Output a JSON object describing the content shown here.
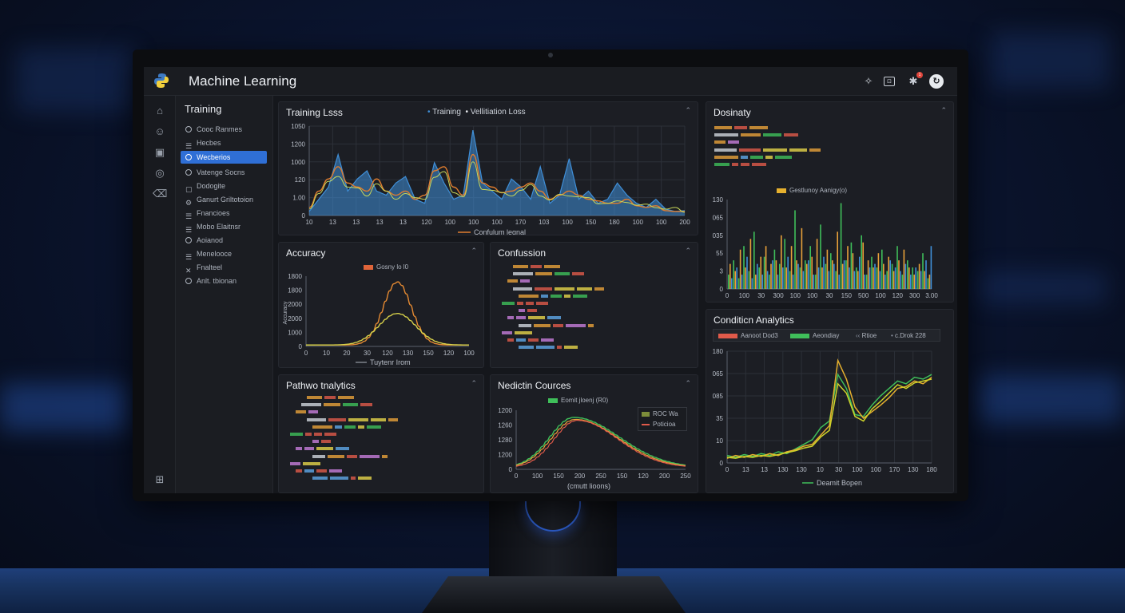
{
  "app": {
    "title": "Machine Learning",
    "icons": [
      "python-logo-icon",
      "share-icon",
      "window-icon",
      "bell-icon",
      "avatar"
    ],
    "notification_count": "1"
  },
  "rail": {
    "icons": [
      "home-icon",
      "people-icon",
      "calendar-icon",
      "chat-icon",
      "trash-icon",
      "box-icon"
    ]
  },
  "sidebar": {
    "title": "Training",
    "items": [
      {
        "label": "Cooc Ranmes",
        "active": false
      },
      {
        "label": "Hecbes",
        "active": false
      },
      {
        "label": "Wecberios",
        "active": true
      },
      {
        "label": "Vatenge Socns",
        "active": false
      },
      {
        "label": "Dodogite",
        "active": false
      },
      {
        "label": "Ganurt Griltotoion",
        "active": false
      },
      {
        "label": "Fnancioes",
        "active": false
      },
      {
        "label": "Mobo Elaitnsr",
        "active": false
      },
      {
        "label": "Aoianod",
        "active": false
      },
      {
        "label": "Menelooce",
        "active": false
      },
      {
        "label": "Fnalteel",
        "active": false
      },
      {
        "label": "Anlt. tbionan",
        "active": false
      }
    ]
  },
  "panels": {
    "training_loss": {
      "title": "Training Lsss",
      "legend_a": "Training",
      "legend_b": "Vellitiation Loss",
      "footer_legend": "Confulum legnal",
      "colors": {
        "a": "#3f8fd8",
        "b": "#e07d2e",
        "c": "#c9d85a"
      }
    },
    "accuracy": {
      "title": "Accuracy",
      "legend": "Gosny lo l0",
      "footer_legend": "Tuytenr Irom",
      "colors": {
        "a": "#e58a32",
        "b": "#d8d24a"
      }
    },
    "confusion": {
      "title": "Confussion"
    },
    "pathwo": {
      "title": "Pathwo tnalytics"
    },
    "prediction": {
      "title": "Nedictin Cources",
      "legend": "Eomit jloenj (R0)",
      "legend_box_a": "ROC Wa",
      "legend_box_b": "Poticioa",
      "footer_legend": "(cmutt lioons)",
      "colors": {
        "a": "#3fbf5a",
        "b": "#e8a13a",
        "c": "#e05a4a"
      }
    },
    "dosinaty": {
      "title": "Dosinaty",
      "chart_legend": "Gestlunoy Aanigy(o)"
    },
    "condition": {
      "title": "Conditicn Analytics",
      "legend_a": "Aanoot Dod3",
      "legend_b": "Aeondiay",
      "legend_c": "Rtioe",
      "legend_d": "c.Drok 228",
      "footer_legend": "Deamit Bopen",
      "colors": {
        "a": "#e05a4a",
        "b": "#3fbf5a",
        "c": "#e6b02e",
        "d": "#cfd42a"
      }
    }
  },
  "chart_data": [
    {
      "type": "area",
      "title": "Training Lsss",
      "y_ticks": [
        "1050",
        "1200",
        "1000",
        "120",
        "1.00",
        "0"
      ],
      "x_ticks": [
        "10",
        "13",
        "13",
        "13",
        "13",
        "120",
        "100",
        "100",
        "100",
        "170",
        "103",
        "100",
        "150",
        "180",
        "100",
        "100",
        "200"
      ],
      "series": [
        {
          "name": "Training",
          "values": [
            5,
            20,
            35,
            75,
            30,
            45,
            55,
            30,
            25,
            40,
            48,
            20,
            15,
            65,
            40,
            20,
            25,
            105,
            40,
            30,
            20,
            45,
            35,
            20,
            60,
            15,
            25,
            70,
            20,
            30,
            15,
            20,
            40,
            25,
            15,
            10,
            20,
            8,
            5,
            6
          ]
        },
        {
          "name": "Vellitiation Loss",
          "values": [
            10,
            30,
            45,
            60,
            40,
            35,
            30,
            45,
            30,
            25,
            30,
            20,
            25,
            55,
            60,
            35,
            25,
            75,
            40,
            35,
            28,
            30,
            35,
            40,
            30,
            20,
            25,
            30,
            25,
            20,
            18,
            15,
            15,
            20,
            12,
            10,
            12,
            6,
            5,
            5
          ]
        }
      ]
    },
    {
      "type": "line",
      "title": "Accuracy",
      "y_ticks": [
        "1800",
        "1800",
        "2000",
        "2000",
        "1000",
        "0"
      ],
      "x_ticks": [
        "0",
        "10",
        "20",
        "30",
        "120",
        "130",
        "150",
        "120",
        "100"
      ],
      "series": [
        {
          "name": "Gosny lo l0",
          "peak": 0.9
        },
        {
          "name": "Tuytenr Irom",
          "peak": 0.45
        }
      ]
    },
    {
      "type": "line",
      "title": "Nedictin Cources",
      "y_ticks": [
        "1200",
        "1260",
        "1280",
        "1200",
        "0"
      ],
      "x_ticks": [
        "0",
        "100",
        "150",
        "200",
        "250",
        "150",
        "120",
        "200",
        "250"
      ],
      "series": [
        {
          "name": "ROC Wa",
          "peak": 0.85
        },
        {
          "name": "Poticioa",
          "peak": 0.8
        }
      ]
    },
    {
      "type": "bar",
      "title": "Gestlunoy Aanigy(o)",
      "y_ticks": [
        "130",
        "065",
        "035",
        "55",
        "3",
        "0"
      ],
      "x_ticks": [
        "0",
        "100",
        "30",
        "300",
        "100",
        "100",
        "30",
        "150",
        "500",
        "100",
        "120",
        "300",
        "3.00"
      ],
      "series": [
        {
          "name": "green",
          "values": [
            20,
            40,
            15,
            60,
            25,
            80,
            30,
            45,
            20,
            55,
            35,
            70,
            25,
            110,
            30,
            40,
            60,
            20,
            90,
            35,
            50,
            25,
            120,
            40,
            65,
            30,
            75,
            20,
            45,
            30,
            55,
            25,
            35,
            60,
            20,
            40,
            30,
            25,
            50,
            15
          ]
        },
        {
          "name": "orange",
          "values": [
            35,
            25,
            55,
            30,
            70,
            20,
            45,
            60,
            35,
            40,
            75,
            30,
            60,
            40,
            85,
            35,
            45,
            70,
            30,
            55,
            40,
            80,
            35,
            60,
            50,
            25,
            65,
            40,
            30,
            50,
            35,
            45,
            25,
            40,
            55,
            30,
            20,
            35,
            25,
            20
          ]
        },
        {
          "name": "blue",
          "values": [
            15,
            30,
            20,
            45,
            15,
            35,
            20,
            25,
            40,
            20,
            30,
            45,
            20,
            35,
            25,
            40,
            20,
            30,
            45,
            25,
            35,
            20,
            40,
            30,
            25,
            45,
            20,
            30,
            35,
            25,
            20,
            40,
            30,
            25,
            35,
            20,
            30,
            25,
            40,
            60
          ]
        }
      ]
    },
    {
      "type": "line",
      "title": "Conditicn Analytics",
      "y_ticks": [
        "180",
        "065",
        "085",
        "35",
        "10",
        "0"
      ],
      "x_ticks": [
        "0",
        "13",
        "13",
        "130",
        "130",
        "10",
        "30",
        "100",
        "100",
        "170",
        "130",
        "180"
      ],
      "series": [
        {
          "name": "Aeondiay",
          "values": [
            8,
            6,
            9,
            7,
            10,
            8,
            12,
            10,
            15,
            20,
            25,
            38,
            45,
            95,
            80,
            52,
            50,
            62,
            72,
            80,
            88,
            85,
            92,
            90,
            95
          ]
        },
        {
          "name": "Rtioe",
          "values": [
            5,
            8,
            6,
            9,
            7,
            10,
            8,
            12,
            14,
            18,
            20,
            30,
            40,
            110,
            90,
            60,
            48,
            55,
            62,
            70,
            80,
            82,
            88,
            85,
            92
          ]
        },
        {
          "name": "c.Drok 228",
          "values": [
            6,
            5,
            7,
            6,
            8,
            7,
            9,
            11,
            13,
            16,
            18,
            28,
            35,
            85,
            75,
            50,
            45,
            58,
            66,
            75,
            84,
            80,
            86,
            88,
            90
          ]
        }
      ]
    }
  ]
}
